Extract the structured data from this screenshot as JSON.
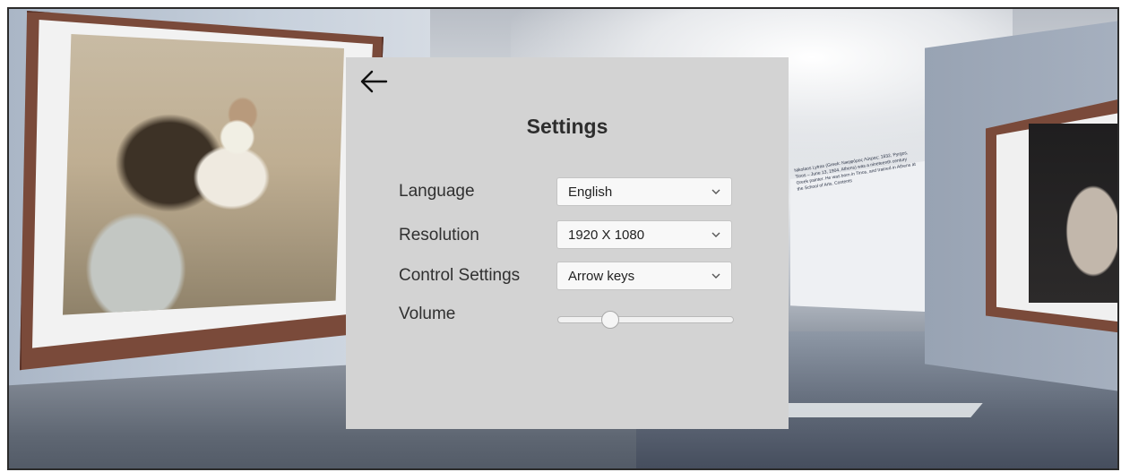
{
  "wall_text": "Nikolaos Lytras (Greek: Νικηφόρος Λύτρας; 1832, Pyrgos, Tinos – June 13, 1904, Athens) was a nineteenth century Greek painter. He was born in Tinos, and trained in Athens at the School of Arts. Contents",
  "settings": {
    "back_icon": "arrow-left-icon",
    "title": "Settings",
    "language": {
      "label": "Language",
      "value": "English"
    },
    "resolution": {
      "label": "Resolution",
      "value": "1920 X 1080"
    },
    "control_settings": {
      "label": "Control Settings",
      "value": "Arrow keys"
    },
    "volume": {
      "label": "Volume",
      "value": 0.3
    }
  },
  "colors": {
    "panel_bg": "#d3d3d3",
    "dropdown_bg": "#f8f8f8",
    "frame_wood": "#7a4a3a"
  }
}
